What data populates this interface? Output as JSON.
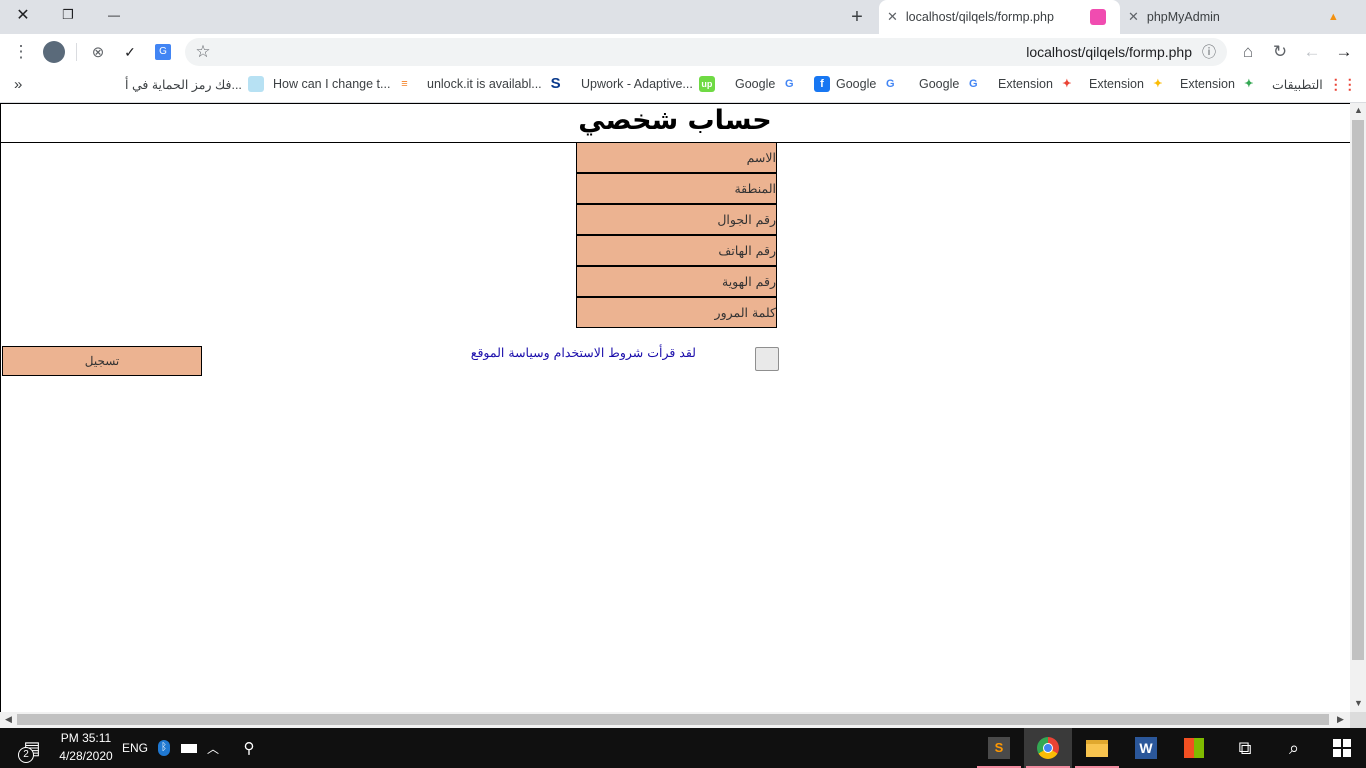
{
  "window": {
    "minimize_icon": "—",
    "restore_icon": "❐",
    "close_icon": "✕"
  },
  "tabs": [
    {
      "title": "localhost/qilqels/formp.php",
      "active": true
    },
    {
      "title": "phpMyAdmin",
      "active": false
    }
  ],
  "new_tab_icon": "+",
  "address_bar": {
    "url": "localhost/qilqels/formp.php"
  },
  "bookmarks": {
    "overflow": "»",
    "items": [
      {
        "label": "فك رمز الحماية في أ...",
        "icon": "image-icon"
      },
      {
        "label": "How can I change t...",
        "icon": "stackoverflow-icon"
      },
      {
        "label": "unlock.it is availabl...",
        "icon": "s-icon"
      },
      {
        "label": "Upwork - Adaptive...",
        "icon": "upwork-icon"
      },
      {
        "label": "Google",
        "icon": "google-icon"
      },
      {
        "label": "Google",
        "icon": "facebook-icon"
      },
      {
        "label": "Google",
        "icon": "google-icon"
      },
      {
        "label": "Extension",
        "icon": "google-icon"
      },
      {
        "label": "Extension",
        "icon": "extension-icon"
      },
      {
        "label": "Extension",
        "icon": "extension-icon"
      },
      {
        "label": "التطبيقات",
        "icon": "apps-icon"
      }
    ]
  },
  "page": {
    "title": "حساب شخصي",
    "fields": [
      {
        "placeholder": "الاسم"
      },
      {
        "placeholder": "المنطقة"
      },
      {
        "placeholder": "رقم الجوال"
      },
      {
        "placeholder": "رقم الهاتف"
      },
      {
        "placeholder": "رقم الهوية"
      },
      {
        "placeholder": "كلمة المرور"
      }
    ],
    "terms_label": "لقد قرأت شروط الاستخدام وسياسة الموقع",
    "register_button": "تسجيل"
  },
  "taskbar": {
    "notification_count": "2",
    "time": "PM 35:11",
    "date": "4/28/2020",
    "language": "ENG"
  },
  "colors": {
    "field_bg": "#ecb391",
    "link": "#1a0dab",
    "taskbar": "#101010",
    "tabstrip": "#dee1e6"
  }
}
